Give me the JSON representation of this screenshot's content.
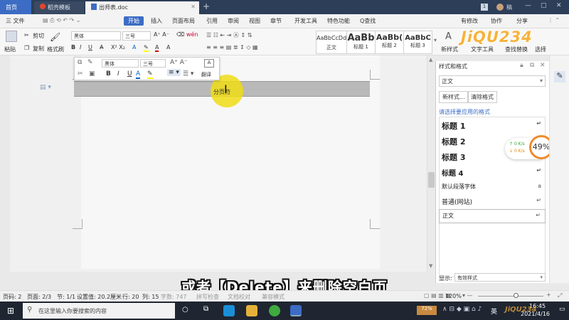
{
  "titlebar": {
    "home_tab": "首页",
    "template_tab": "稻壳模板",
    "doc_tab": "出师表.doc",
    "badge": "1",
    "user": "稿"
  },
  "menubar": {
    "file": "三 文件",
    "items": [
      "开始",
      "插入",
      "页面布局",
      "引用",
      "审阅",
      "视图",
      "章节",
      "开发工具",
      "特色功能"
    ],
    "search": "Q查找",
    "unsaved": "有修改",
    "collab": "协作",
    "share": "分享"
  },
  "ribbon": {
    "paste": "粘贴",
    "cut": "剪切",
    "copy": "复制",
    "format_painter": "格式刷",
    "font": "黑体",
    "size": "三号",
    "styles": [
      {
        "preview": "AaBbCcDd",
        "label": "正文"
      },
      {
        "preview": "AaBb",
        "label": "标题 1"
      },
      {
        "preview": "AaBb(",
        "label": "标题 2"
      },
      {
        "preview": "AaBbC",
        "label": "标题 3"
      }
    ],
    "new_style": "新样式",
    "text_tools": "文字工具",
    "find_replace": "查找替换",
    "select": "选择"
  },
  "float_toolbar": {
    "font": "黑体",
    "size": "三号",
    "translate": "翻译"
  },
  "document": {
    "page_break_label": "分页符"
  },
  "pane": {
    "title": "样式和格式",
    "current_style": "正文",
    "new_style_btn": "新样式...",
    "clear_btn": "清除格式",
    "hint": "请选择要应用的格式",
    "items": [
      "标题 1",
      "标题 2",
      "标题 3",
      "标题 4",
      "默认段落字体",
      "普通(网站)",
      "正文"
    ],
    "show_label": "显示:",
    "show_value": "有效样式"
  },
  "net_widget": {
    "up": "0 K/s",
    "down": "0 K/s",
    "percent": "49%"
  },
  "statusbar": {
    "page_num": "页码: 2",
    "pages": "页面: 2/3",
    "section": "节: 1/1",
    "setting": "设置值: 20.2厘米",
    "row": "行: 20",
    "col": "列: 15",
    "words": "字数: 747",
    "spell": "拼写检查",
    "proof": "文档校对",
    "compat": "兼容模式",
    "zoom": "120%",
    "zoom_level": 0.58
  },
  "subtitle": "或者【Delete】来删除空白页",
  "taskbar": {
    "search_placeholder": "在这里输入你要搜索的内容",
    "time": "16:45",
    "date": "2021/4/16",
    "ime": "英"
  },
  "watermark": "JiQU234",
  "colors": {
    "accent": "#3c6cc4",
    "titlebar": "#2c3e58",
    "highlight": "#f0dc14"
  }
}
